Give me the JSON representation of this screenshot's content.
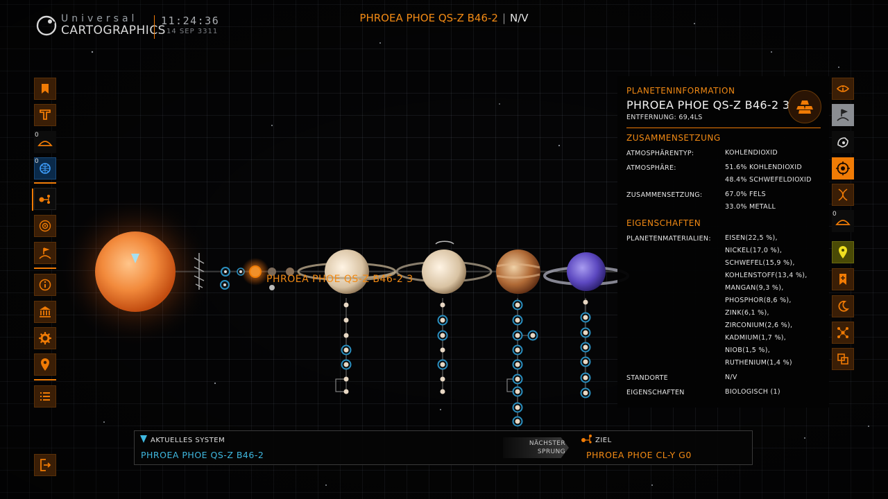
{
  "header": {
    "brand_top": "Universal",
    "brand_main": "CARTOGRAPHICS",
    "time": "11:24:36",
    "date": "14 SEP 3311",
    "system_title": "PHROEA PHOE QS-Z B46-2",
    "separator": "|",
    "system_status": "N/V"
  },
  "left_sidebar": {
    "items": [
      {
        "icon": "bookmark-icon",
        "count": ""
      },
      {
        "icon": "filter-icon",
        "count": ""
      },
      {
        "icon": "landable-icon",
        "count": "0"
      },
      {
        "icon": "globe-icon",
        "count": "0"
      },
      {
        "icon": "system-map-icon",
        "count": ""
      },
      {
        "icon": "target-icon",
        "count": ""
      },
      {
        "icon": "flag-planet-icon",
        "count": ""
      },
      {
        "icon": "info-icon",
        "count": ""
      },
      {
        "icon": "bank-icon",
        "count": ""
      },
      {
        "icon": "gear-icon",
        "count": ""
      },
      {
        "icon": "location-pin-icon",
        "count": ""
      },
      {
        "icon": "list-icon",
        "count": ""
      },
      {
        "icon": "exit-icon",
        "count": ""
      }
    ]
  },
  "right_sidebar": {
    "items": [
      {
        "icon": "info-circle-icon",
        "count": ""
      },
      {
        "icon": "flag-icon",
        "count": ""
      },
      {
        "icon": "probe-icon",
        "count": ""
      },
      {
        "icon": "planet-target-icon",
        "count": ""
      },
      {
        "icon": "dna-icon",
        "count": ""
      },
      {
        "icon": "landable-icon",
        "count": "0"
      },
      {
        "icon": "map-pin-icon",
        "count": ""
      },
      {
        "icon": "bookmark-plus-icon",
        "count": ""
      },
      {
        "icon": "moon-icon",
        "count": ""
      },
      {
        "icon": "network-icon",
        "count": ""
      },
      {
        "icon": "compare-icon",
        "count": ""
      }
    ]
  },
  "system_view": {
    "selected_planet_label": "PHROEA PHOE QS-Z B46-2 3"
  },
  "planet_panel": {
    "heading": "PLANETENINFORMATION",
    "name": "PHROEA PHOE QS-Z B46-2 3",
    "distance_label": "ENTFERNUNG:",
    "distance_value": "69,4LS",
    "composition_heading": "ZUSAMMENSETZUNG",
    "atmosphere_type_label": "ATMOSPHÄRENTYP:",
    "atmosphere_type_value": "KOHLENDIOXID",
    "atmosphere_label": "ATMOSPHÄRE:",
    "atmosphere_values": [
      "51.6% KOHLENDIOXID",
      "48.4% SCHWEFELDIOXID"
    ],
    "composition_label": "ZUSAMMENSETZUNG:",
    "composition_values": [
      "67.0% FELS",
      "33.0% METALL"
    ],
    "properties_heading": "EIGENSCHAFTEN",
    "materials_label": "PLANETENMATERIALIEN:",
    "materials": [
      "EISEN(22,5 %),",
      "NICKEL(17,0 %),",
      "SCHWEFEL(15,9 %),",
      "KOHLENSTOFF(13,4 %),",
      "MANGAN(9,3 %),",
      "PHOSPHOR(8,6 %),",
      "ZINK(6,1 %),",
      "ZIRCONIUM(2,6 %),",
      "KADMIUM(1,7 %),",
      "NIOB(1,5 %),",
      "RUTHENIUM(1,4 %)"
    ],
    "locations_label": "STANDORTE",
    "locations_value": "N/V",
    "features_label": "EIGENSCHAFTEN",
    "features_value": "BIOLOGISCH (1)"
  },
  "route_bar": {
    "current_label": "AKTUELLES SYSTEM",
    "current_value": "PHROEA PHOE QS-Z B46-2",
    "next_jump_line1": "NÄCHSTER",
    "next_jump_line2": "SPRUNG",
    "target_label": "ZIEL",
    "target_value": "PHROEA PHOE CL-Y G0"
  },
  "colors": {
    "accent": "#f07b05",
    "cyan": "#3fb8e0",
    "moon_ring": "#2a8fc0"
  }
}
